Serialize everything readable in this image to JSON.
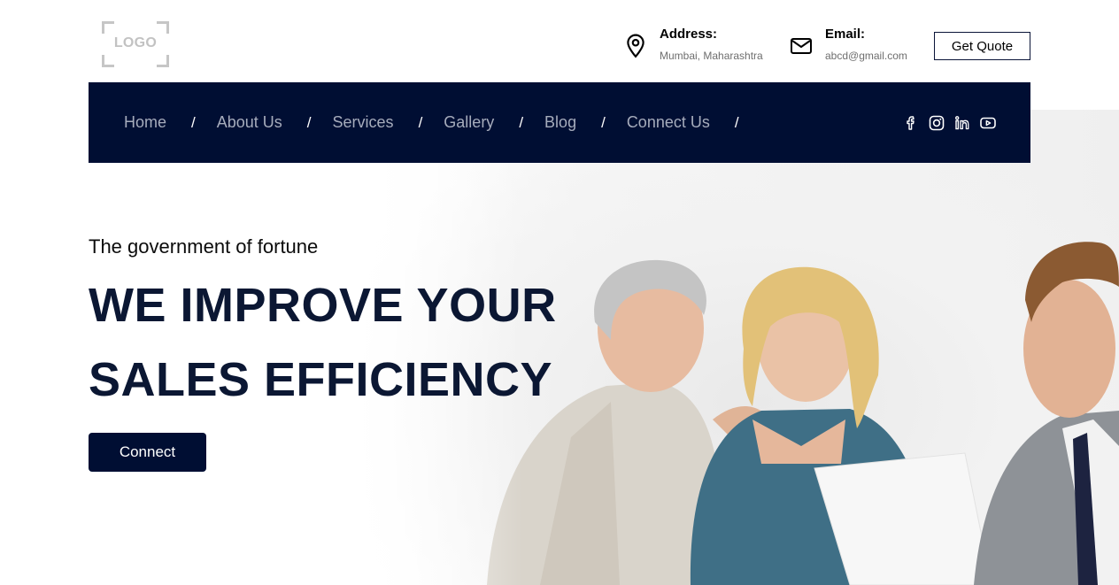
{
  "header": {
    "logo_text": "LOGO",
    "address": {
      "title": "Address:",
      "value": "Mumbai, Maharashtra",
      "icon": "map-pin-icon"
    },
    "email": {
      "title": "Email:",
      "value": "abcd@gmail.com",
      "icon": "mail-icon"
    },
    "quote_label": "Get Quote"
  },
  "nav": {
    "items": [
      {
        "label": "Home"
      },
      {
        "label": "About Us"
      },
      {
        "label": "Services"
      },
      {
        "label": "Gallery"
      },
      {
        "label": "Blog"
      },
      {
        "label": "Connect Us"
      }
    ],
    "separator": "/",
    "social": [
      "facebook-icon",
      "instagram-icon",
      "linkedin-icon",
      "youtube-icon"
    ]
  },
  "hero": {
    "tagline": "The government of fortune",
    "headline_line1": "WE IMPROVE YOUR",
    "headline_line2": "SALES EFFICIENCY",
    "button_label": "Connect"
  },
  "colors": {
    "navy": "#000e33",
    "nav_text": "#a6acbc",
    "headline": "#0b1733"
  }
}
